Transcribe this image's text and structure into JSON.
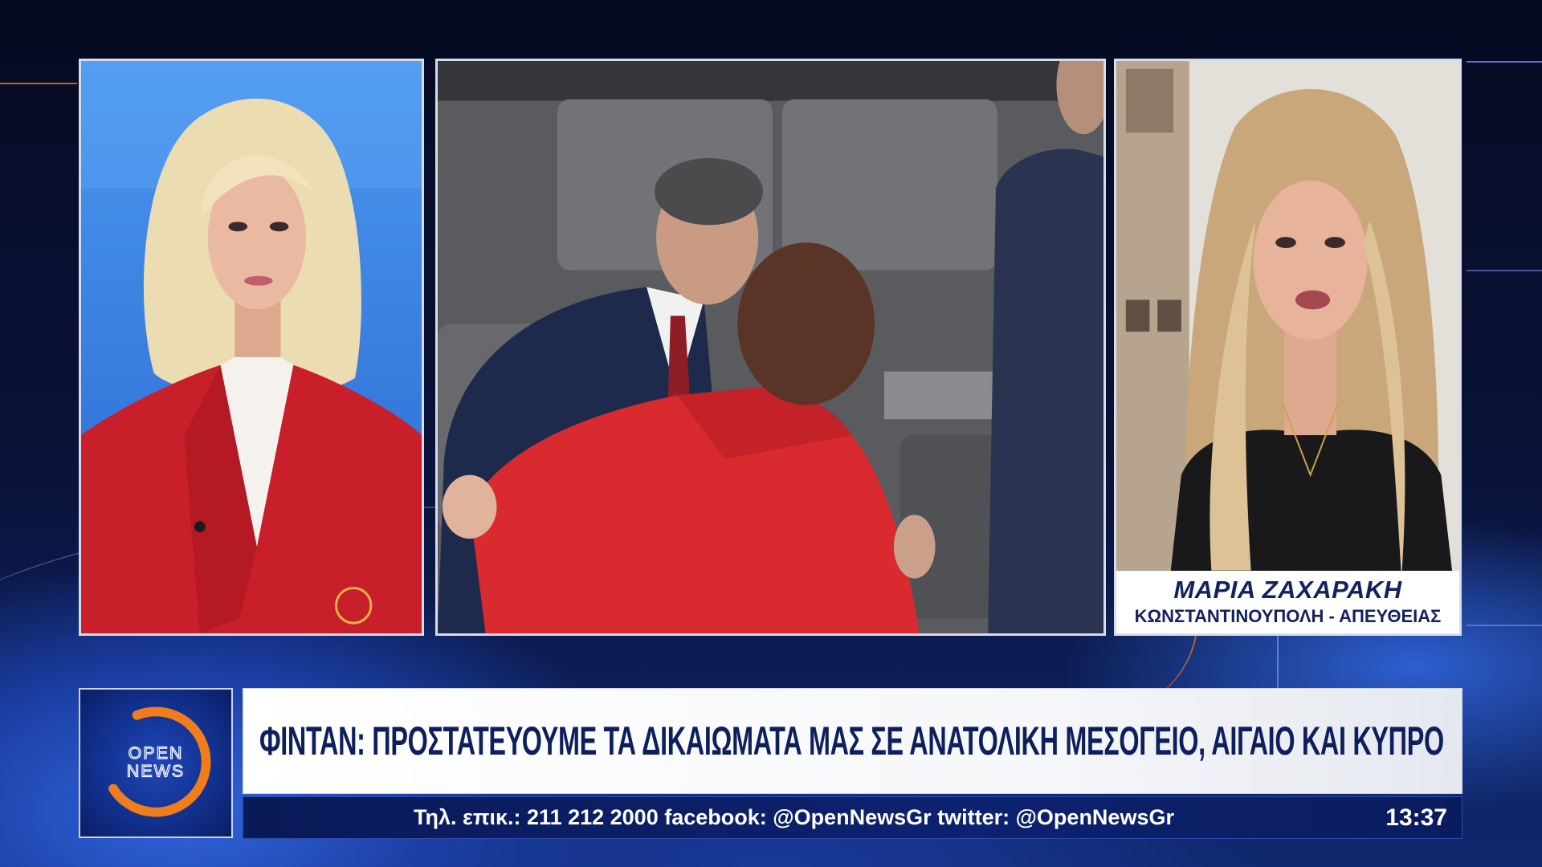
{
  "channel": {
    "logo_line1": "OPEN",
    "logo_line2": "NEWS"
  },
  "guest": {
    "name": "ΜΑΡΙΑ ΖΑΧΑΡΑΚΗ",
    "location": "ΚΩΝΣΤΑΝΤΙΝΟΥΠΟΛΗ - ΑΠΕΥΘΕΙΑΣ"
  },
  "headline": "ΦΙΝΤΑΝ: ΠΡΟΣΤΑΤΕΥΟΥΜΕ ΤΑ ΔΙΚΑΙΩΜΑΤΑ ΜΑΣ ΣΕ ΑΝΑΤΟΛΙΚΗ ΜΕΣΟΓΕΙΟ, ΑΙΓΑΙΟ ΚΑΙ ΚΥΠΡΟ",
  "ticker": {
    "contact": "Τηλ. επικ.: 211 212 2000 facebook: @OpenNewsGr twitter: @OpenNewsGr",
    "time": "13:37"
  },
  "colors": {
    "accent": "#f07d1c",
    "navy": "#0e1f5d",
    "ticker_background": "#0a1a58",
    "headline_background": "#ffffff",
    "page_background": "#0a133a"
  },
  "icons": {
    "logo": "open-news-logo"
  }
}
